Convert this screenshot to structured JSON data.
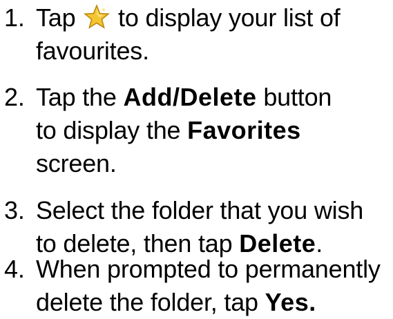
{
  "steps": [
    {
      "number": "1.",
      "line1_before": "Tap ",
      "star_icon": "favourites-star-icon",
      "line1_after": " to display your list of",
      "line2": "favourites."
    },
    {
      "number": "2.",
      "line1_before": "Tap the ",
      "line1_bold": "Add/Delete",
      "line1_after": " button",
      "line2_before": "to display the ",
      "line2_bold": "Favorites",
      "line3": "screen."
    },
    {
      "number": "3.",
      "line1": "Select the folder that you wish",
      "line2_before": "to delete, then tap ",
      "line2_bold": "Delete",
      "line2_after": "."
    },
    {
      "number": "4.",
      "line1": "When prompted to permanently",
      "line2_before": "delete the folder, tap ",
      "line2_bold": "Yes."
    }
  ],
  "colors": {
    "text": "#000000",
    "star_fill": "#f5c431",
    "star_stroke": "#b8860b"
  }
}
